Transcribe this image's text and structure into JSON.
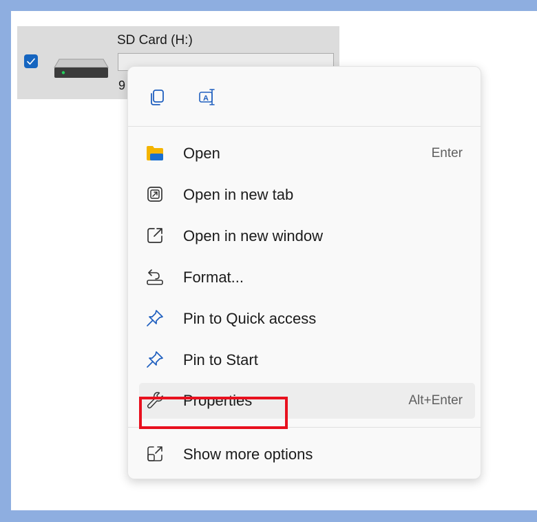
{
  "drive": {
    "name": "SD Card (H:)",
    "free_text_partial": "9",
    "checked": true
  },
  "context_menu": {
    "quick_actions": [
      {
        "name": "copy",
        "icon": "copy-icon"
      },
      {
        "name": "rename",
        "icon": "rename-icon"
      }
    ],
    "items": [
      {
        "label": "Open",
        "shortcut": "Enter",
        "icon": "folder-icon"
      },
      {
        "label": "Open in new tab",
        "shortcut": "",
        "icon": "open-new-tab-icon"
      },
      {
        "label": "Open in new window",
        "shortcut": "",
        "icon": "open-new-window-icon"
      },
      {
        "label": "Format...",
        "shortcut": "",
        "icon": "format-icon"
      },
      {
        "label": "Pin to Quick access",
        "shortcut": "",
        "icon": "pin-icon"
      },
      {
        "label": "Pin to Start",
        "shortcut": "",
        "icon": "pin-icon"
      },
      {
        "label": "Properties",
        "shortcut": "Alt+Enter",
        "icon": "wrench-icon"
      }
    ],
    "more": {
      "label": "Show more options",
      "icon": "show-more-icon"
    }
  },
  "colors": {
    "accent": "#1565c0",
    "highlight_box": "#e8101e",
    "folder_yellow": "#f4b400",
    "page_border": "#8eaee0"
  }
}
